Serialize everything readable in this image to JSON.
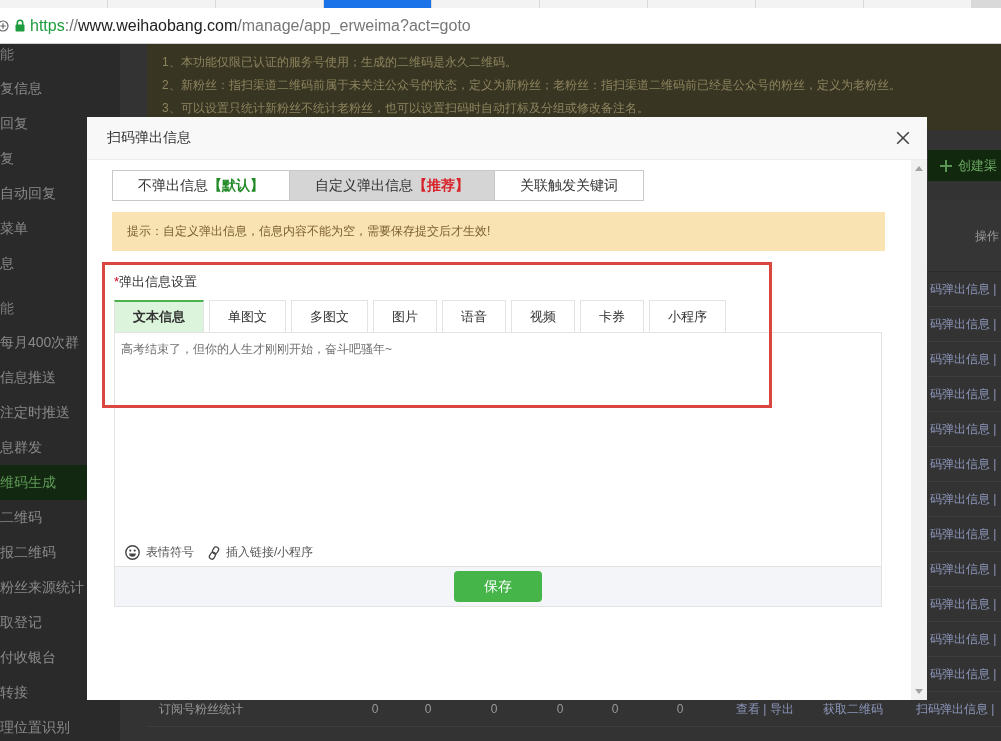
{
  "browser": {
    "tabs": [
      {
        "selected": false
      },
      {
        "selected": false
      },
      {
        "selected": false
      },
      {
        "selected": true
      },
      {
        "selected": false
      },
      {
        "selected": false
      },
      {
        "selected": false
      },
      {
        "selected": false
      },
      {
        "selected": false
      }
    ],
    "address": {
      "scheme": "https",
      "separator": "://",
      "host": "www.weihaobang.com",
      "path": "/manage/app_erweima?act=goto"
    }
  },
  "sidebar": {
    "groups": [
      {
        "title": "能",
        "items": [
          {
            "label": "复信息",
            "selected": false
          },
          {
            "label": "回复",
            "selected": false
          },
          {
            "label": "复",
            "selected": false
          },
          {
            "label": "自动回复",
            "selected": false
          },
          {
            "label": "菜单",
            "selected": false
          },
          {
            "label": "息",
            "selected": false
          }
        ]
      },
      {
        "title": "能",
        "items": [
          {
            "label": "每月400次群",
            "selected": false
          },
          {
            "label": "信息推送",
            "selected": false
          },
          {
            "label": "注定时推送",
            "selected": false
          },
          {
            "label": "息群发",
            "selected": false
          },
          {
            "label": "维码生成",
            "selected": true
          },
          {
            "label": "二维码",
            "selected": false
          },
          {
            "label": "报二维码",
            "selected": false
          },
          {
            "label": "粉丝来源统计",
            "selected": false
          },
          {
            "label": "取登记",
            "selected": false
          },
          {
            "label": "付收银台",
            "selected": false
          },
          {
            "label": "转接",
            "selected": false
          },
          {
            "label": "理位置识别",
            "selected": false
          }
        ]
      }
    ]
  },
  "notice": {
    "lines": [
      "1、本功能仅限已认证的服务号使用；生成的二维码是永久二维码。",
      "2、新粉丝：指扫渠道二维码前属于未关注公众号的状态，定义为新粉丝；老粉丝：指扫渠道二维码前已经是公众号的粉丝，定义为老粉丝。",
      "3、可以设置只统计新粉丝不统计老粉丝，也可以设置扫码时自动打标及分组或修改备注名。"
    ]
  },
  "create_button": {
    "label": "创建渠"
  },
  "table": {
    "columns": [
      {
        "label": "操作"
      }
    ],
    "rows": [
      {
        "kind": "partial",
        "operation": "码弹出信息",
        "separator": "|"
      },
      {
        "kind": "partial",
        "operation": "码弹出信息",
        "separator": "|"
      },
      {
        "kind": "partial",
        "operation": "码弹出信息",
        "separator": "|"
      },
      {
        "kind": "partial",
        "operation": "码弹出信息",
        "separator": "|"
      },
      {
        "kind": "partial",
        "operation": "码弹出信息",
        "separator": "|"
      },
      {
        "kind": "partial",
        "operation": "码弹出信息",
        "separator": "|"
      },
      {
        "kind": "partial",
        "operation": "码弹出信息",
        "separator": "|"
      },
      {
        "kind": "partial",
        "operation": "码弹出信息",
        "separator": "|"
      },
      {
        "kind": "partial",
        "operation": "码弹出信息",
        "separator": "|"
      },
      {
        "kind": "partial",
        "operation": "码弹出信息",
        "separator": "|"
      },
      {
        "kind": "partial",
        "operation": "码弹出信息",
        "separator": "|"
      },
      {
        "kind": "partial",
        "operation": "码弹出信息",
        "separator": "|"
      },
      {
        "kind": "full",
        "name": "订阅号粉丝统计",
        "counts": [
          "0",
          "0",
          "0",
          "0",
          "0",
          "0"
        ],
        "view_link": "查看",
        "link_separator": "|",
        "export_link": "导出",
        "qrcode_link": "获取二维码",
        "operation": "扫码弹出信息",
        "separator": "|"
      }
    ]
  },
  "dialog": {
    "title": "扫码弹出信息",
    "mode_tabs": [
      {
        "label": "不弹出信息",
        "tag": {
          "text": "【默认】",
          "color": "#238a27"
        },
        "selected": false
      },
      {
        "label": "自定义弹出信息",
        "tag": {
          "text": "【推荐】",
          "color": "#d9232a"
        },
        "selected": true
      },
      {
        "label": "关联触发关键词",
        "selected": false
      }
    ],
    "hint": "提示：自定义弹出信息，信息内容不能为空，需要保存提交后才生效!",
    "section": {
      "required_mark": "*",
      "label": "弹出信息设置",
      "content_tabs": [
        {
          "label": "文本信息",
          "selected": true
        },
        {
          "label": "单图文",
          "selected": false
        },
        {
          "label": "多图文",
          "selected": false
        },
        {
          "label": "图片",
          "selected": false
        },
        {
          "label": "语音",
          "selected": false
        },
        {
          "label": "视频",
          "selected": false
        },
        {
          "label": "卡券",
          "selected": false
        },
        {
          "label": "小程序",
          "selected": false
        }
      ],
      "message": {
        "value": "高考结束了，但你的人生才刚刚开始，奋斗吧骚年~"
      },
      "tools": [
        {
          "kind": "emoji",
          "label": "表情符号"
        },
        {
          "kind": "link",
          "label": "插入链接/小程序"
        }
      ]
    },
    "save_button": "保存"
  }
}
